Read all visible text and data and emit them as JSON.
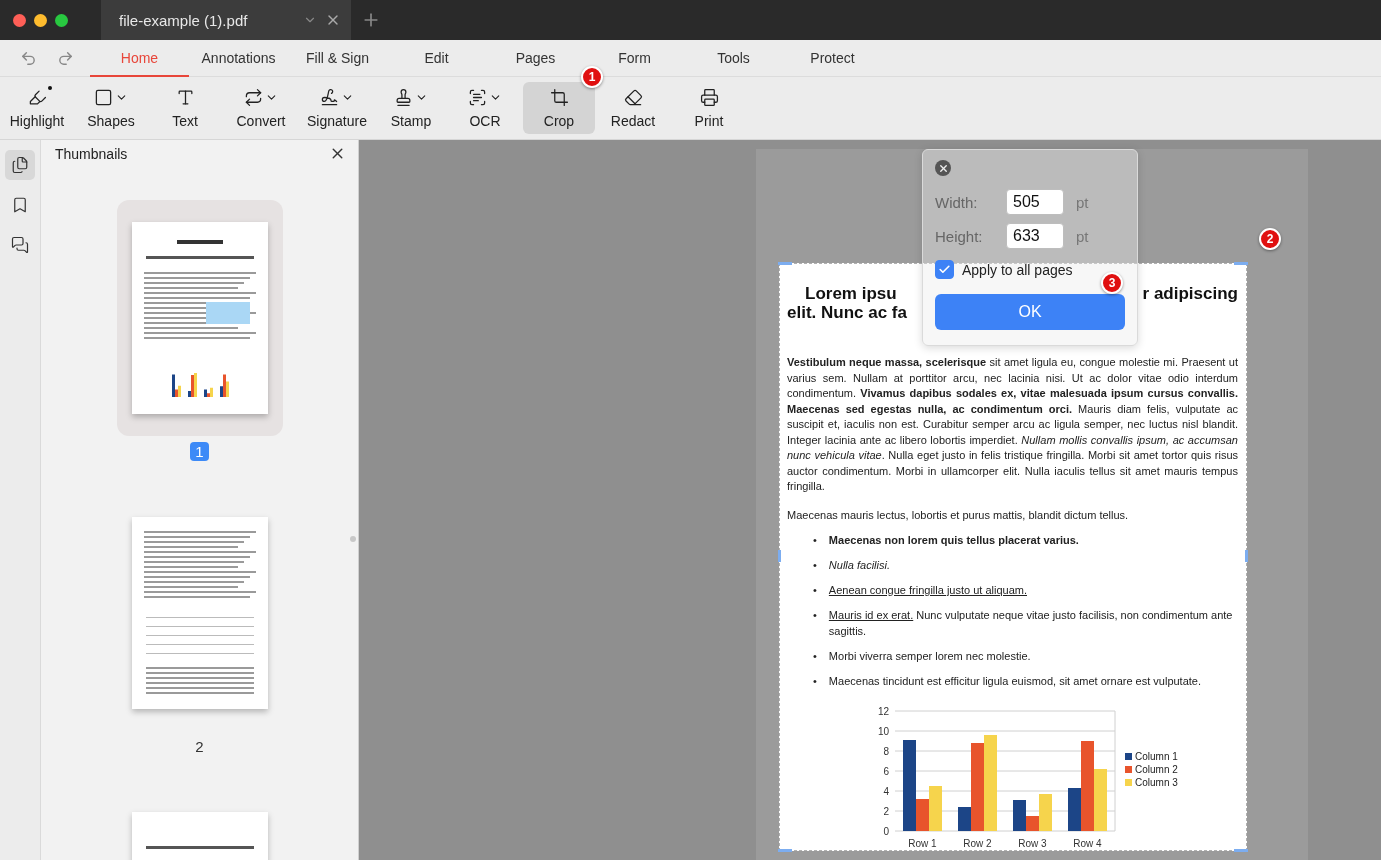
{
  "window": {
    "tab_title": "file-example (1).pdf"
  },
  "menu_tabs": [
    {
      "label": "Home",
      "selected": true
    },
    {
      "label": "Annotations",
      "selected": false
    },
    {
      "label": "Fill & Sign",
      "selected": false
    },
    {
      "label": "Edit",
      "selected": false
    },
    {
      "label": "Pages",
      "selected": false
    },
    {
      "label": "Form",
      "selected": false
    },
    {
      "label": "Tools",
      "selected": false
    },
    {
      "label": "Protect",
      "selected": false
    }
  ],
  "toolbar": [
    {
      "kind": "highlight",
      "label": "Highlight",
      "dropdown": false,
      "selected": false,
      "divider_before": false
    },
    {
      "kind": "shapes",
      "label": "Shapes",
      "dropdown": true,
      "selected": false,
      "divider_before": false
    },
    {
      "kind": "text",
      "label": "Text",
      "dropdown": false,
      "selected": false,
      "divider_before": false
    },
    {
      "kind": "convert",
      "label": "Convert",
      "dropdown": true,
      "selected": false,
      "divider_before": true
    },
    {
      "kind": "signature",
      "label": "Signature",
      "dropdown": true,
      "selected": false,
      "divider_before": false
    },
    {
      "kind": "stamp",
      "label": "Stamp",
      "dropdown": true,
      "selected": false,
      "divider_before": false
    },
    {
      "kind": "ocr",
      "label": "OCR",
      "dropdown": true,
      "selected": false,
      "divider_before": false
    },
    {
      "kind": "crop",
      "label": "Crop",
      "dropdown": false,
      "selected": true,
      "divider_before": false
    },
    {
      "kind": "redact",
      "label": "Redact",
      "dropdown": false,
      "selected": false,
      "divider_before": false
    },
    {
      "kind": "print",
      "label": "Print",
      "dropdown": false,
      "selected": false,
      "divider_before": true
    }
  ],
  "sidebar": {
    "items": [
      {
        "kind": "pages",
        "selected": true
      },
      {
        "kind": "bookmarks",
        "selected": false
      },
      {
        "kind": "comments",
        "selected": false
      }
    ]
  },
  "thumbnails": {
    "title": "Thumbnails",
    "pages": [
      {
        "number": "1",
        "selected": true
      },
      {
        "number": "2",
        "selected": false
      },
      {
        "selected": false
      }
    ]
  },
  "document": {
    "heading": {
      "line_1_left": "Lorem ipsu",
      "line_1_right": "r adipiscing",
      "line_2": "elit. Nunc ac fa"
    },
    "paragraph": "**Vestibulum neque massa, scelerisque** sit amet ligula eu, congue molestie mi. Praesent ut varius sem. Nullam at porttitor arcu, nec lacinia nisi. Ut ac dolor vitae odio interdum condimentum. **Vivamus dapibus sodales ex, vitae malesuada ipsum cursus convallis. Maecenas sed egestas nulla, ac condimentum orci.** Mauris diam felis, vulputate ac suscipit et, iaculis non est. Curabitur semper arcu ac ligula semper, nec luctus nisl blandit. Integer lacinia ante ac libero lobortis imperdiet. *Nullam mollis convallis ipsum, ac accumsan nunc vehicula vitae*. Nulla eget justo in felis tristique fringilla. Morbi sit amet tortor quis risus auctor condimentum. Morbi in ullamcorper elit. Nulla iaculis tellus sit amet mauris tempus fringilla.",
    "intro": "Maecenas mauris lectus, lobortis et purus mattis, blandit dictum tellus.",
    "bullets": [
      {
        "marker": "•",
        "kind": "bold",
        "text": "Maecenas non lorem quis tellus placerat varius."
      },
      {
        "marker": "•",
        "kind": "italic",
        "text": "Nulla facilisi."
      },
      {
        "marker": "•",
        "kind": "underline",
        "text": "Aenean congue fringilla justo ut aliquam."
      },
      {
        "marker": "•",
        "kind": "mixed",
        "underlined": "Mauris id ex erat.",
        "text": "Nunc vulputate neque vitae justo facilisis, non condimentum ante sagittis."
      },
      {
        "marker": "•",
        "kind": "plain",
        "text": "Morbi viverra semper lorem nec molestie."
      },
      {
        "marker": "•",
        "kind": "plain",
        "text": "Maecenas tincidunt est efficitur ligula euismod, sit amet ornare est vulputate."
      }
    ],
    "chart_data": {
      "type": "bar",
      "categories": [
        "Row 1",
        "Row 2",
        "Row 3",
        "Row 4"
      ],
      "ylim": [
        0,
        12
      ],
      "yticks": [
        0,
        2,
        4,
        6,
        8,
        10,
        12
      ],
      "grid": true,
      "legend": "right",
      "series": [
        {
          "name": "Column 1",
          "color": "#1c4587",
          "values": [
            9.1,
            2.4,
            3.1,
            4.3
          ]
        },
        {
          "name": "Column 2",
          "color": "#e8542c",
          "values": [
            3.2,
            8.8,
            1.5,
            9.0
          ]
        },
        {
          "name": "Column 3",
          "color": "#f6d44c",
          "values": [
            4.5,
            9.6,
            3.7,
            6.2
          ]
        }
      ]
    }
  },
  "crop_popup": {
    "width_label": "Width:",
    "width_value": "505",
    "width_unit": "pt",
    "height_label": "Height:",
    "height_value": "633",
    "height_unit": "pt",
    "apply_all": {
      "label": "Apply to all pages",
      "checked": true
    },
    "ok": "OK"
  },
  "markers": [
    "1",
    "2",
    "3"
  ]
}
